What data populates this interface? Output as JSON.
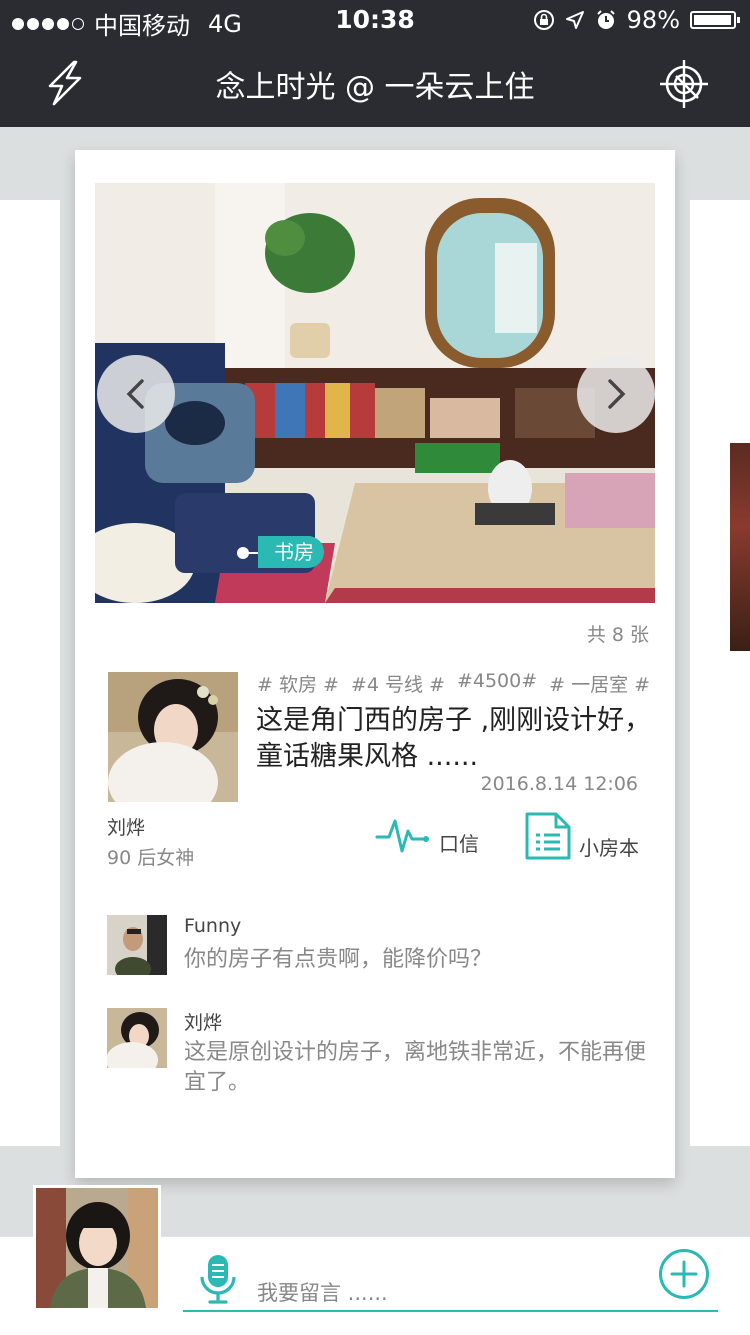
{
  "status_bar": {
    "carrier": "中国移动",
    "network": "4G",
    "time": "10:38",
    "battery": "98%",
    "battery_level": 0.98
  },
  "nav": {
    "title": "念上时光 @ 一朵云上住"
  },
  "card": {
    "room_tag": "书房",
    "photo_count": "共 8 张",
    "author": {
      "name": "刘烨",
      "subtitle": "90 后女神"
    },
    "tags": [
      "# 软房 #",
      "#4 号线 #",
      "#4500#",
      "# 一居室 #"
    ],
    "description": "这是角门西的房子 ,刚刚设计好，童话糖果风格 ......",
    "timestamp": "2016.8.14 12:06",
    "actions": {
      "message": "口信",
      "notebook": "小房本"
    },
    "comments": [
      {
        "name": "Funny",
        "text": "你的房子有点贵啊，能降价吗？"
      },
      {
        "name": "刘烨",
        "text": "这是原创设计的房子，离地铁非常近，不能再便宜了。"
      }
    ]
  },
  "input": {
    "placeholder": "我要留言 ......"
  },
  "colors": {
    "accent": "#2bb9b3",
    "bar_bg": "#2b2c31",
    "page_bg": "#dcdfdf"
  },
  "icons": {
    "nav_left": "lightning-icon",
    "nav_right": "crosshair-icon",
    "mic": "microphone-icon",
    "add": "plus-circle-icon",
    "message": "pulse-icon",
    "notebook": "document-icon"
  }
}
